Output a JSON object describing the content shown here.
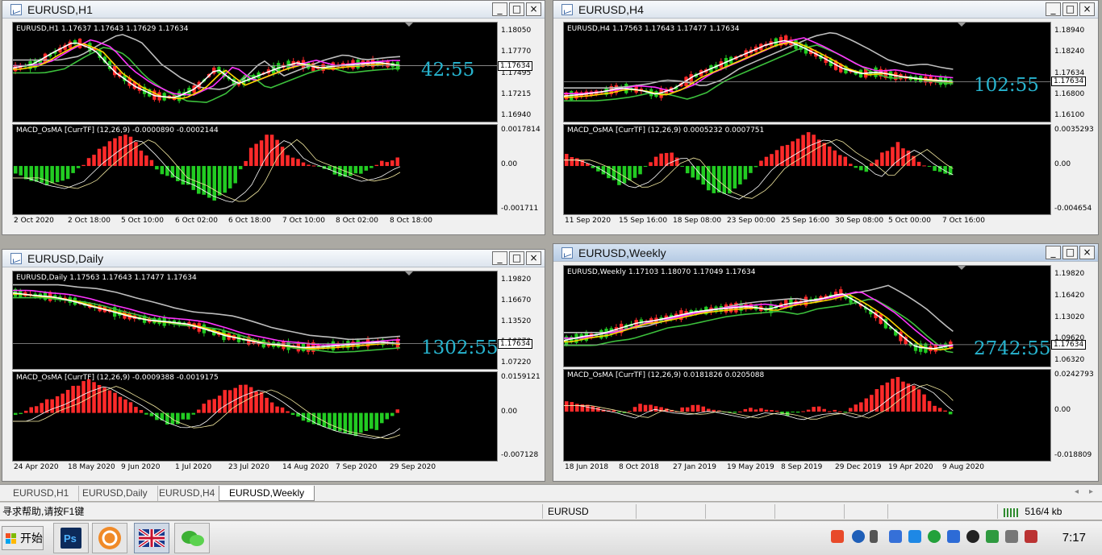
{
  "windows": [
    {
      "title": "EURUSD,H1",
      "ohlc": "EURUSD,H1  1.17637 1.17643 1.17629 1.17634",
      "timer": "42:55",
      "price_levels": [
        "1.18050",
        "1.17770",
        "1.17495",
        "1.17215",
        "1.16940"
      ],
      "current_price": "1.17634",
      "osc_label": "MACD_OsMA [CurrTF] (12,26,9) -0.0000890 -0.0002144",
      "osc_levels": [
        "0.0017814",
        "0.00",
        "-0.001711"
      ],
      "time_labels": [
        "2 Oct 2020",
        "2 Oct 18:00",
        "5 Oct 10:00",
        "6 Oct 02:00",
        "6 Oct 18:00",
        "7 Oct 10:00",
        "8 Oct 02:00",
        "8 Oct 18:00"
      ]
    },
    {
      "title": "EURUSD,H4",
      "ohlc": "EURUSD,H4  1.17563 1.17643 1.17477 1.17634",
      "timer": "102:55",
      "price_levels": [
        "1.18940",
        "1.18240",
        "1.17634",
        "1.16800",
        "1.16100"
      ],
      "current_price": "1.17634",
      "osc_label": "MACD_OsMA [CurrTF] (12,26,9) 0.0005232 0.0007751",
      "osc_levels": [
        "0.0035293",
        "0.00",
        "-0.004654"
      ],
      "time_labels": [
        "11 Sep 2020",
        "15 Sep 16:00",
        "18 Sep 08:00",
        "23 Sep 00:00",
        "25 Sep 16:00",
        "30 Sep 08:00",
        "5 Oct 00:00",
        "7 Oct 16:00"
      ]
    },
    {
      "title": "EURUSD,Daily",
      "ohlc": "EURUSD,Daily  1.17563 1.17643 1.17477 1.17634",
      "timer": "1302:55",
      "price_levels": [
        "1.19820",
        "1.16670",
        "1.13520",
        "1.10370",
        "1.07220"
      ],
      "current_price": "1.17634",
      "osc_label": "MACD_OsMA [CurrTF] (12,26,9) -0.0009388 -0.0019175",
      "osc_levels": [
        "0.0159121",
        "0.00",
        "-0.007128"
      ],
      "time_labels": [
        "24 Apr 2020",
        "18 May 2020",
        "9 Jun 2020",
        "1 Jul 2020",
        "23 Jul 2020",
        "14 Aug 2020",
        "7 Sep 2020",
        "29 Sep 2020"
      ]
    },
    {
      "title": "EURUSD,Weekly",
      "ohlc": "EURUSD,Weekly  1.17103 1.18070 1.17049 1.17634",
      "timer": "2742:55",
      "price_levels": [
        "1.19820",
        "1.16420",
        "1.13020",
        "1.09620",
        "1.06320"
      ],
      "current_price": "1.17634",
      "osc_label": "MACD_OsMA [CurrTF] (12,26,9) 0.0181826 0.0205088",
      "osc_levels": [
        "0.0242793",
        "0.00",
        "-0.018809"
      ],
      "time_labels": [
        "18 Jun 2018",
        "8 Oct 2018",
        "27 Jan 2019",
        "19 May 2019",
        "8 Sep 2019",
        "29 Dec 2019",
        "19 Apr 2020",
        "9 Aug 2020"
      ]
    }
  ],
  "window_buttons": {
    "minimize": "_",
    "maximize": "□",
    "close": "×"
  },
  "tabs": [
    "EURUSD,H1",
    "EURUSD,Daily",
    "EURUSD,H4",
    "EURUSD,Weekly"
  ],
  "tab_scroll": {
    "left": "◂",
    "right": "▸"
  },
  "status": {
    "help": "寻求帮助,请按F1键",
    "symbol": "EURUSD",
    "traffic": "516/4 kb"
  },
  "taskbar": {
    "start": "开始",
    "clock": "7:17"
  },
  "colors": {
    "bull": "#ff2a2a",
    "bear": "#22cc22",
    "ma_fast": "#ffffff",
    "ma_mid": "#ffd700",
    "ma_slow": "#ff33ff",
    "ma_trend": "#3cc03c",
    "ma_long": "#bdbdbd",
    "timer": "#27b4cf"
  }
}
